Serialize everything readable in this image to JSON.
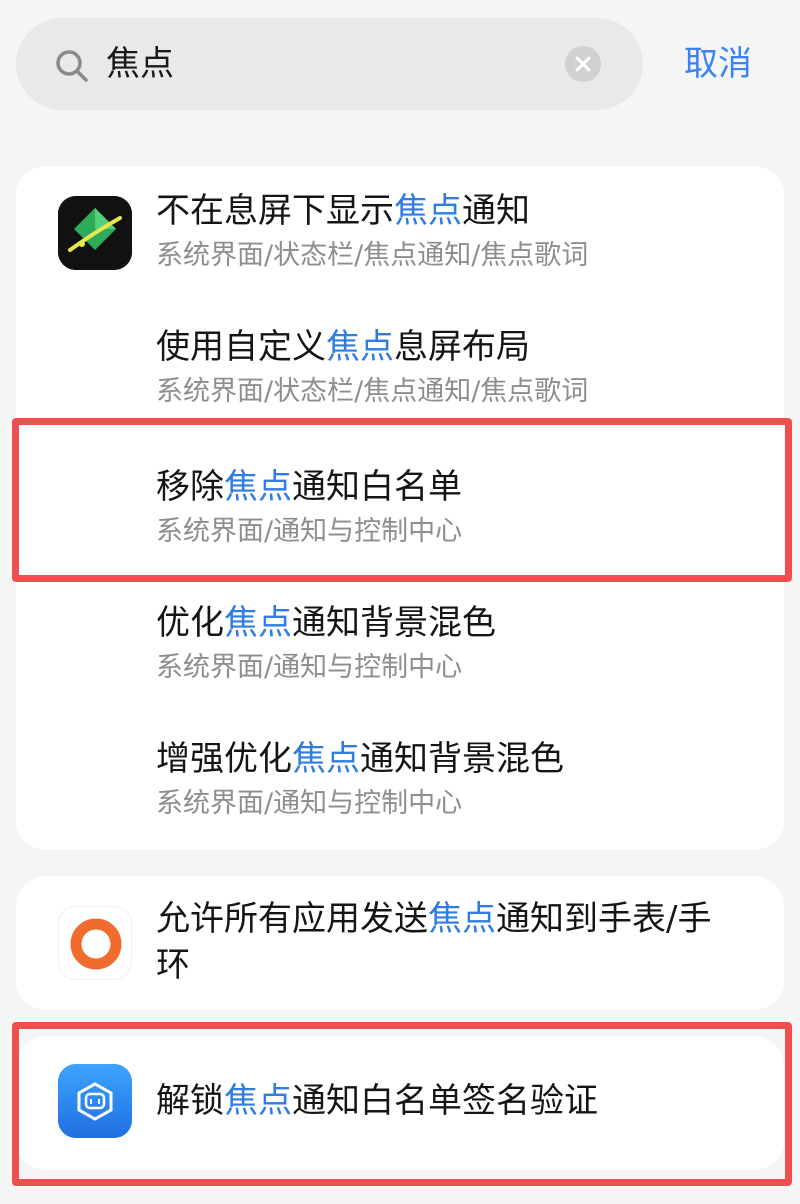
{
  "search": {
    "query": "焦点",
    "cancel_label": "取消"
  },
  "results_group_1": [
    {
      "title_before": "不在息屏下显示",
      "title_hl": "焦点",
      "title_after": "通知",
      "subtitle": "系统界面/状态栏/焦点通知/焦点歌词",
      "icon": "theme-app-icon"
    },
    {
      "title_before": "使用自定义",
      "title_hl": "焦点",
      "title_after": "息屏布局",
      "subtitle": "系统界面/状态栏/焦点通知/焦点歌词"
    },
    {
      "title_before": "移除",
      "title_hl": "焦点",
      "title_after": "通知白名单",
      "subtitle": "系统界面/通知与控制中心"
    },
    {
      "title_before": "优化",
      "title_hl": "焦点",
      "title_after": "通知背景混色",
      "subtitle": "系统界面/通知与控制中心"
    },
    {
      "title_before": "增强优化",
      "title_hl": "焦点",
      "title_after": "通知背景混色",
      "subtitle": "系统界面/通知与控制中心"
    }
  ],
  "result_watch": {
    "title_before": "允许所有应用发送",
    "title_hl": "焦点",
    "title_after_line1": "通知到手表/手",
    "title_line2": "环",
    "icon": "ring-app-icon"
  },
  "result_unlock": {
    "title_before": "解锁",
    "title_hl": "焦点",
    "title_after": "通知白名单签名验证",
    "icon": "mi-app-icon"
  },
  "colors": {
    "highlight": "#2f7de1",
    "annotation": "#ef4f4f",
    "accent": "#3b82f6"
  }
}
